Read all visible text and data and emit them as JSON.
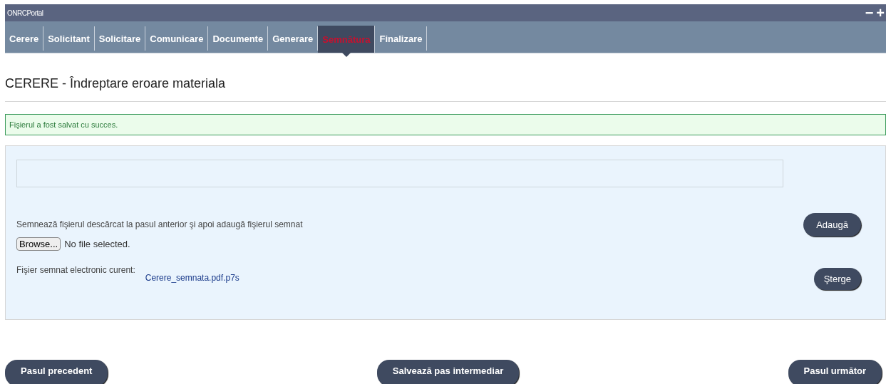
{
  "window": {
    "title": "ONRCPortal",
    "controls": [
      "−",
      "+"
    ]
  },
  "tabs": [
    {
      "label": "Cerere",
      "selected": false
    },
    {
      "label": "Solicitant",
      "selected": false
    },
    {
      "label": "Solicitare",
      "selected": false
    },
    {
      "label": "Comunicare",
      "selected": false
    },
    {
      "label": "Documente",
      "selected": false
    },
    {
      "label": "Generare",
      "selected": false
    },
    {
      "label": "Semnătura",
      "selected": true
    },
    {
      "label": "Finalizare",
      "selected": false
    }
  ],
  "heading": "CERERE - Îndreptare eroare materiala",
  "success_message": "Fişierul a fost salvat cu succes.",
  "upload": {
    "instruction": "Semnează fişierul descărcat la pasul anterior şi apoi adaugă fişierul semnat",
    "browse_button": "Browse...",
    "file_status": "No file selected.",
    "add_button": "Adaugă",
    "current_label": "Fişier semnat electronic curent:",
    "current_file": "Cerere_semnata.pdf.p7s",
    "delete_button": "Şterge"
  },
  "footer_buttons": [
    "Pasul precedent",
    "Salvează pas intermediar",
    "Pasul următor"
  ]
}
